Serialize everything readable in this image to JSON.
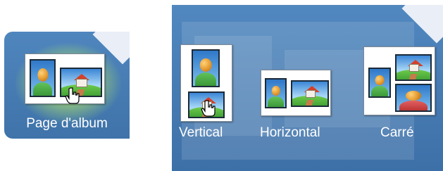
{
  "left": {
    "label": "Page d'album"
  },
  "right": {
    "options": [
      {
        "label": "Vertical"
      },
      {
        "label": "Horizontal"
      },
      {
        "label": "Carré"
      }
    ]
  },
  "colors": {
    "tile_blue": "#4a80b7",
    "glow": "#dff58c",
    "text": "#ffffff"
  }
}
